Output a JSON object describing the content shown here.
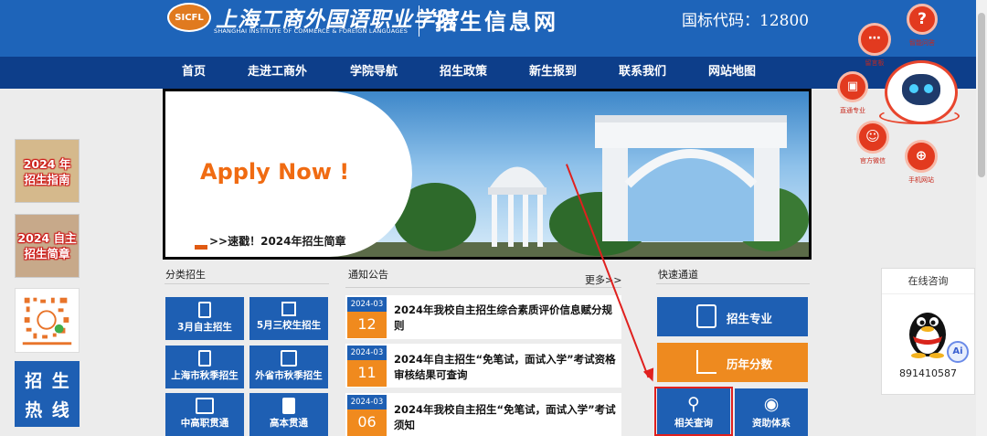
{
  "header": {
    "logo_text": "SICFL",
    "school_cn": "上海工商外国语职业学院",
    "school_en": "SHANGHAI INSTITUTE OF COMMERCE & FOREIGN LANGUAGES",
    "site_title": "招生信息网",
    "gb_code": "国标代码：12800"
  },
  "nav": [
    "首页",
    "走进工商外",
    "学院导航",
    "招生政策",
    "新生报到",
    "联系我们",
    "网站地图"
  ],
  "banner": {
    "headline": "Apply Now !",
    "link_text": ">>速戳！2024年招生简章"
  },
  "left_sidebar": {
    "guide": "2024 年\n招生指南",
    "brochure": "2024 自主\n招生简章",
    "hotline": [
      "招",
      "生",
      "热",
      "线"
    ]
  },
  "categories": {
    "title": "分类招生",
    "items": [
      "3月自主招生",
      "5月三校生招生",
      "上海市秋季招生",
      "外省市秋季招生",
      "中高职贯通",
      "高本贯通"
    ]
  },
  "notices": {
    "title": "通知公告",
    "more": "更多>>",
    "items": [
      {
        "year": "2024-03",
        "day": "12",
        "title": "2024年我校自主招生综合素质评价信息赋分规则"
      },
      {
        "year": "2024-03",
        "day": "11",
        "title": "2024年自主招生“免笔试，面试入学”考试资格审核结果可查询"
      },
      {
        "year": "2024-03",
        "day": "06",
        "title": "2024年我校自主招生“免笔试，面试入学”考试须知"
      }
    ]
  },
  "quick": {
    "title": "快速通道",
    "major": "招生专业",
    "scores": "历年分数",
    "query": "相关查询",
    "aid": "资助体系"
  },
  "float_menu": {
    "message": "留言板",
    "smart": "智能问答",
    "major": "直通专业",
    "wechat": "官方微信",
    "mobile": "手机网站"
  },
  "consult": {
    "title": "在线咨询",
    "qq": "891410587",
    "ai": "Ai"
  },
  "colors": {
    "brand_blue": "#1e64b9",
    "nav_blue": "#0d3e8a",
    "accent_orange": "#f08a1e",
    "highlight_red": "#e0201e"
  },
  "icons": [
    "logo-badge",
    "book-icon",
    "list-icon",
    "document-icon",
    "reader-icon",
    "search-icon",
    "medal-icon",
    "chart-icon",
    "id-card-icon",
    "qq-penguin-icon",
    "robot-icon"
  ]
}
